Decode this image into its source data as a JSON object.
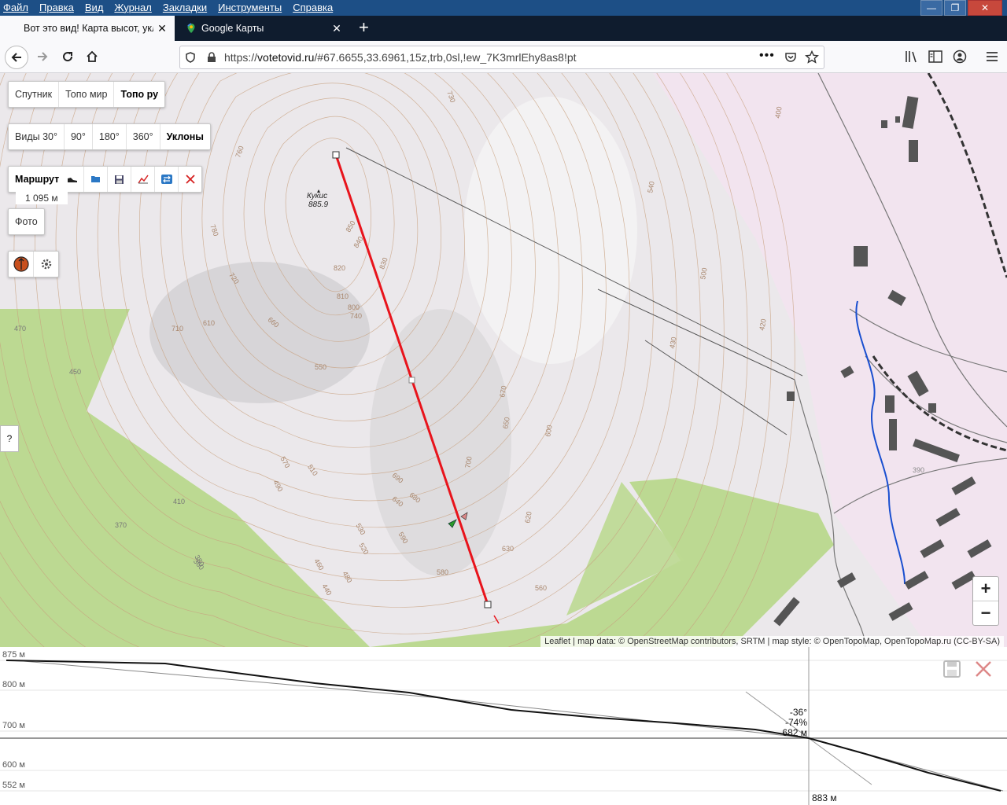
{
  "menu": [
    "Файл",
    "Правка",
    "Вид",
    "Журнал",
    "Закладки",
    "Инструменты",
    "Справка"
  ],
  "window_buttons": {
    "minimize": "—",
    "maximize": "❐",
    "close": "✕"
  },
  "tabs": [
    {
      "title": "Вот это вид! Карта высот, укл",
      "active": true
    },
    {
      "title": "Google Карты",
      "active": false
    }
  ],
  "newtab_label": "+",
  "url": {
    "prefix": "https://",
    "host": "votetovid.ru",
    "path": "/#67.6655,33.6961,15z,trb,0sl,!ew_7K3mrlEhy8as8!pt"
  },
  "map_controls": {
    "layers": [
      {
        "label": "Спутник",
        "selected": false
      },
      {
        "label": "Топо мир",
        "selected": false
      },
      {
        "label": "Топо ру",
        "selected": true
      }
    ],
    "views": [
      {
        "label": "Виды 30°",
        "selected": false
      },
      {
        "label": "90°",
        "selected": false
      },
      {
        "label": "180°",
        "selected": false
      },
      {
        "label": "360°",
        "selected": false
      },
      {
        "label": "Уклоны",
        "selected": true
      }
    ],
    "route_label": "Маршрут",
    "route_length": "1 095 м",
    "photo_label": "Фото",
    "help_label": "?",
    "zoom_in": "+",
    "zoom_out": "−"
  },
  "map_labels": {
    "peak_name": "Кукис",
    "peak_elev": "885.9",
    "contours": [
      "760",
      "780",
      "850",
      "840",
      "830",
      "820",
      "810",
      "800",
      "740",
      "720",
      "660",
      "610",
      "710",
      "550",
      "570",
      "510",
      "490",
      "470",
      "450",
      "410",
      "370",
      "380",
      "440",
      "460",
      "480",
      "520",
      "530",
      "590",
      "640",
      "680",
      "690",
      "700",
      "630",
      "620",
      "600",
      "580",
      "560",
      "670",
      "650",
      "540",
      "500",
      "420",
      "430",
      "400",
      "390",
      "360",
      "730"
    ]
  },
  "attribution": "Leaflet | map data: © OpenStreetMap contributors, SRTM | map style: © OpenTopoMap, OpenTopoMap.ru (CC-BY-SA)",
  "profile": {
    "y_labels": [
      "875 м",
      "800 м",
      "700 м",
      "600 м",
      "552 м"
    ],
    "cursor_slope_deg": "-36°",
    "cursor_slope_pct": "-74%",
    "cursor_elev": "682 м",
    "cursor_dist": "883 м"
  },
  "colors": {
    "route": "#e8141c",
    "forest": "#b9da8f",
    "urban": "#f0e2ef",
    "titlebar": "#1d4f86"
  }
}
